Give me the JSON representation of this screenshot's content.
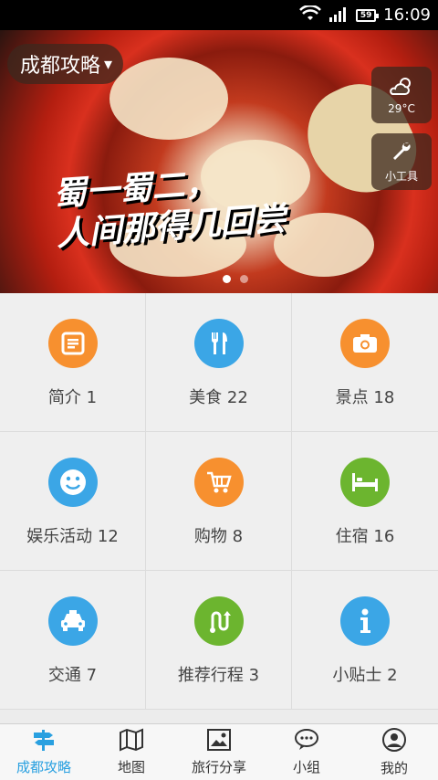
{
  "status_bar": {
    "battery": "59",
    "time": "16:09"
  },
  "banner": {
    "slogan_line1": "蜀一蜀二，",
    "slogan_line2": "人间那得几回尝",
    "active_dot": 0,
    "dot_count": 2
  },
  "city_selector": {
    "label": "成都攻略",
    "arrow": "▾"
  },
  "weather": {
    "temp": "29°C",
    "icon": "partly-cloudy-icon"
  },
  "tools": {
    "label": "小工具",
    "icon": "wrench-icon"
  },
  "grid": [
    {
      "label": "简介 1",
      "color": "#f7902f",
      "icon": "document-icon"
    },
    {
      "label": "美食 22",
      "color": "#3ba6e6",
      "icon": "fork-knife-icon"
    },
    {
      "label": "景点 18",
      "color": "#f7902f",
      "icon": "camera-icon"
    },
    {
      "label": "娱乐活动 12",
      "color": "#3ba6e6",
      "icon": "smiley-icon"
    },
    {
      "label": "购物 8",
      "color": "#f7902f",
      "icon": "cart-icon"
    },
    {
      "label": "住宿 16",
      "color": "#6cb52f",
      "icon": "bed-icon"
    },
    {
      "label": "交通 7",
      "color": "#3ba6e6",
      "icon": "taxi-icon"
    },
    {
      "label": "推荐行程 3",
      "color": "#6cb52f",
      "icon": "route-icon"
    },
    {
      "label": "小贴士 2",
      "color": "#3ba6e6",
      "icon": "info-icon"
    }
  ],
  "tabs": [
    {
      "label": "成都攻略",
      "icon": "signpost-icon",
      "active": true
    },
    {
      "label": "地图",
      "icon": "map-icon",
      "active": false
    },
    {
      "label": "旅行分享",
      "icon": "picture-icon",
      "active": false
    },
    {
      "label": "小组",
      "icon": "chat-icon",
      "active": false
    },
    {
      "label": "我的",
      "icon": "profile-icon",
      "active": false
    }
  ],
  "colors": {
    "accent": "#29a0e0",
    "orange": "#f7902f",
    "blue": "#3ba6e6",
    "green": "#6cb52f"
  }
}
